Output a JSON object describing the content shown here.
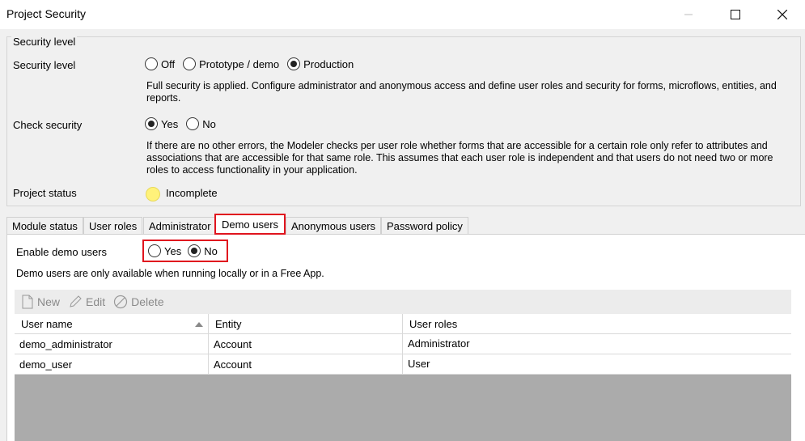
{
  "window": {
    "title": "Project Security",
    "icons": {
      "minimize": "minimize-icon",
      "maximize": "maximize-icon",
      "close": "close-icon"
    }
  },
  "security": {
    "group_title": "Security level",
    "level_label": "Security level",
    "level_options": [
      "Off",
      "Prototype / demo",
      "Production"
    ],
    "level_selected": "Production",
    "level_desc": "Full security is applied. Configure administrator and anonymous access and define user roles and security for forms, microflows, entities, and reports.",
    "check_label": "Check security",
    "check_options": [
      "Yes",
      "No"
    ],
    "check_selected": "Yes",
    "check_desc": "If there are no other errors, the Modeler checks per user role whether forms that are accessible for a certain role only refer to attributes and associations that are accessible for that same role. This assumes that each user role is independent and that users do not need two or more roles to access functionality in your application.",
    "status_label": "Project status",
    "status_value": "Incomplete",
    "status_color": "#fff27a"
  },
  "tabs": [
    "Module status",
    "User roles",
    "Administrator",
    "Demo users",
    "Anonymous users",
    "Password policy"
  ],
  "active_tab": "Demo users",
  "demo": {
    "enable_label": "Enable demo users",
    "options": [
      "Yes",
      "No"
    ],
    "selected": "No",
    "note": "Demo users are only available when running locally or in a Free App.",
    "toolbar": {
      "new": "New",
      "edit": "Edit",
      "delete": "Delete"
    },
    "columns": [
      "User name",
      "Entity",
      "User roles"
    ],
    "rows": [
      {
        "user": "demo_administrator",
        "entity": "Account",
        "roles": "Administrator"
      },
      {
        "user": "demo_user",
        "entity": "Account",
        "roles": "User"
      }
    ]
  },
  "colors": {
    "highlight": "#e0141e",
    "grid_empty": "#ababab"
  }
}
